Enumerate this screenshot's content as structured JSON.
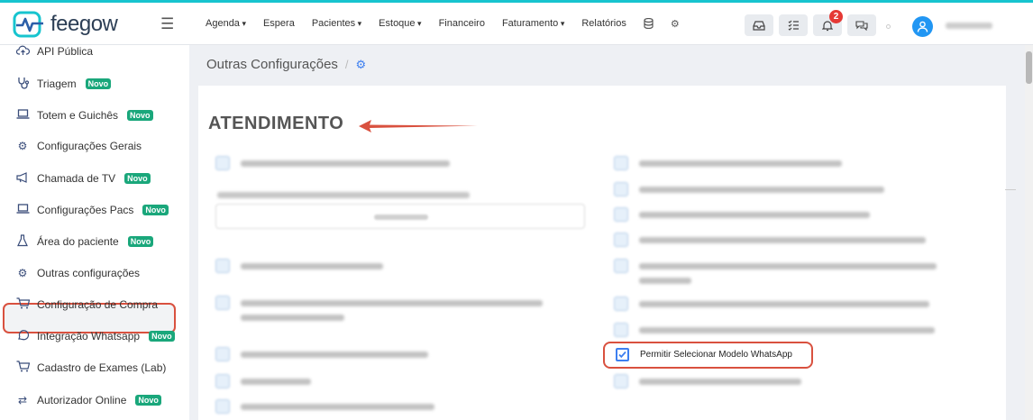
{
  "app": {
    "logo_text": "feegow",
    "brand_color": "#17c4cf"
  },
  "topnav": {
    "items": [
      {
        "label": "Agenda",
        "dropdown": true
      },
      {
        "label": "Espera",
        "dropdown": false
      },
      {
        "label": "Pacientes",
        "dropdown": true
      },
      {
        "label": "Estoque",
        "dropdown": true
      },
      {
        "label": "Financeiro",
        "dropdown": false
      },
      {
        "label": "Faturamento",
        "dropdown": true
      },
      {
        "label": "Relatórios",
        "dropdown": false
      }
    ],
    "extra_icons": [
      "database-icon",
      "gear-icon"
    ],
    "toolbar_icons": [
      "inbox-icon",
      "checklist-icon",
      "bell-icon",
      "chat-icon"
    ],
    "notification_count": "2"
  },
  "sidebar": {
    "badge_label": "Novo",
    "items": [
      {
        "label": "API Pública",
        "icon": "cloud-upload-icon",
        "novo": false
      },
      {
        "label": "Triagem",
        "icon": "stethoscope-icon",
        "novo": true
      },
      {
        "label": "Totem e Guichês",
        "icon": "laptop-icon",
        "novo": true
      },
      {
        "label": "Configurações Gerais",
        "icon": "gears-icon",
        "novo": false
      },
      {
        "label": "Chamada de TV",
        "icon": "megaphone-icon",
        "novo": true
      },
      {
        "label": "Configurações Pacs",
        "icon": "laptop-icon",
        "novo": true
      },
      {
        "label": "Área do paciente",
        "icon": "flask-icon",
        "novo": true
      },
      {
        "label": "Outras configurações",
        "icon": "gears-icon",
        "novo": false,
        "active": true
      },
      {
        "label": "Configuração de Compra",
        "icon": "cart-icon",
        "novo": false
      },
      {
        "label": "Integração Whatsapp",
        "icon": "whatsapp-icon",
        "novo": true
      },
      {
        "label": "Cadastro de Exames (Lab)",
        "icon": "cart-icon",
        "novo": false
      },
      {
        "label": "Autorizador Online",
        "icon": "exchange-icon",
        "novo": true
      }
    ]
  },
  "breadcrumb": {
    "title": "Outras Configurações",
    "separator": "/",
    "icon": "gears-icon"
  },
  "section": {
    "title": "ATENDIMENTO"
  },
  "options": {
    "highlighted_label": "Permitir Selecionar Modelo WhatsApp",
    "highlighted_checked": true
  },
  "colors": {
    "highlight_border": "#d9513f",
    "novo_badge": "#1aa77b",
    "checkbox_blue": "#3d7ff0",
    "avatar_blue": "#2196f3"
  }
}
